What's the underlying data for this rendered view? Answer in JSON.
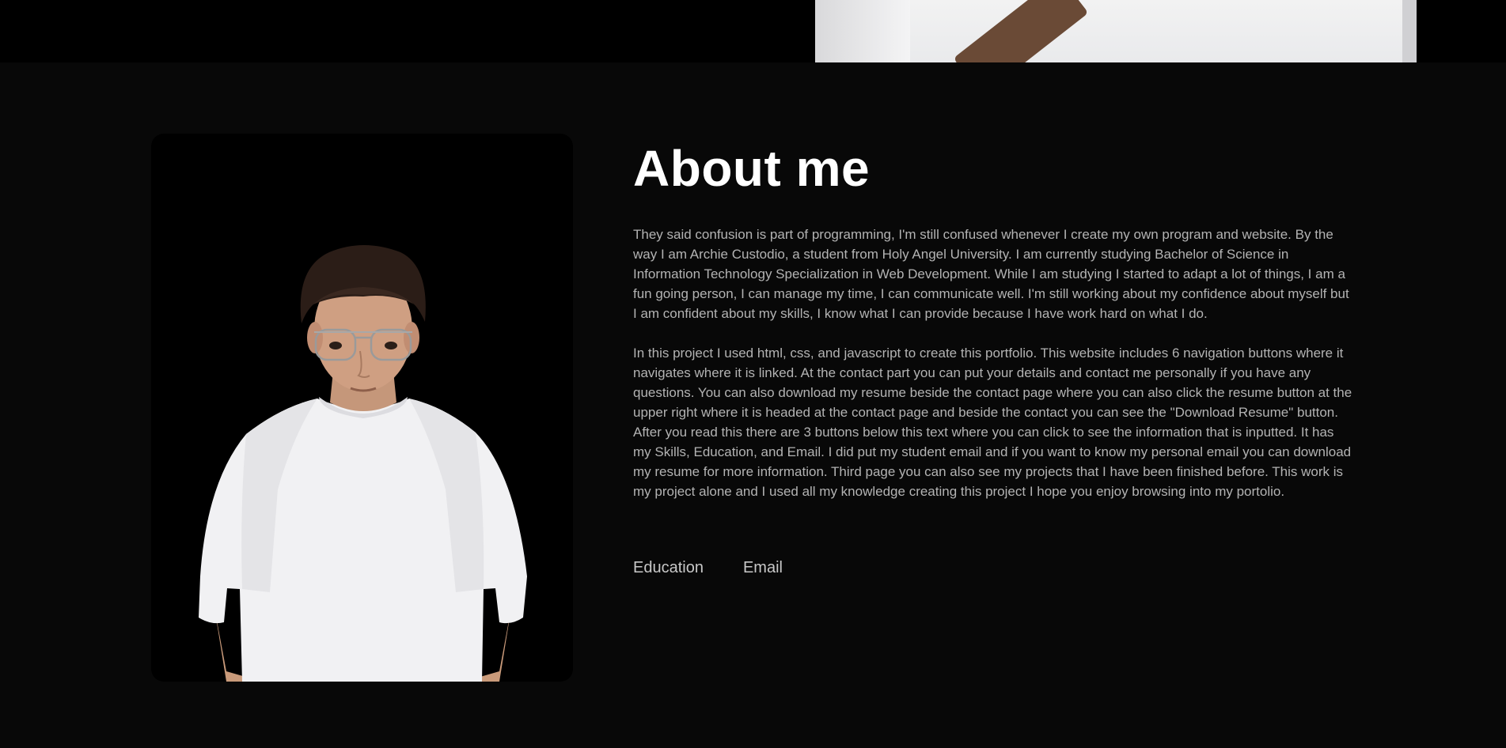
{
  "about": {
    "title": "About me",
    "paragraph_1": "They said confusion is part of programming, I'm still confused whenever I create my own program and website. By the way I am Archie Custodio, a student from Holy Angel University. I am currently studying Bachelor of Science in Information Technology Specialization in Web Development. While I am studying I started to adapt a lot of things, I am a fun going person, I can manage my time, I can communicate well. I'm still working about my confidence about myself but I am confident about my skills, I know what I can provide because I have work hard on what I do.",
    "paragraph_2": "In this project I used html, css, and javascript to create this portfolio. This website includes 6 navigation buttons where it navigates where it is linked. At the contact part you can put your details and contact me personally if you have any questions. You can also download my resume beside the contact page where you can also click the resume button at the upper right where it is headed at the contact page and beside the contact you can see the \"Download Resume\" button. After you read this there are 3 buttons below this text where you can click to see the information that is inputted. It has my Skills, Education, and Email. I did put my student email and if you want to know my personal email you can download my resume for more information. Third page you can also see my projects that I have been finished before. This work is my project alone and I used all my knowledge creating this project I hope you enjoy browsing into my portolio.",
    "tabs": [
      {
        "label": "Education"
      },
      {
        "label": "Email"
      }
    ]
  },
  "colors": {
    "background": "#080808",
    "top_strip": "#000000",
    "title": "#ffffff",
    "body_text": "#b3b3b3"
  }
}
